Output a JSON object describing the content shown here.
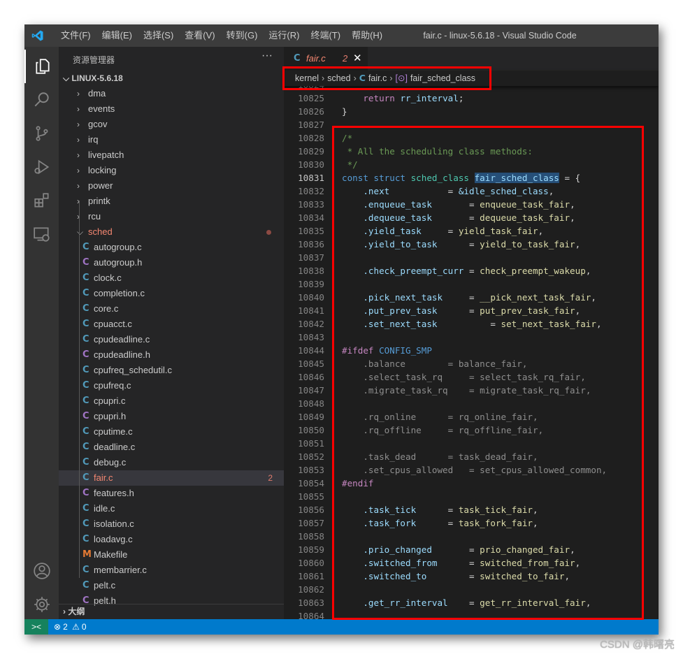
{
  "titlebar": {
    "menu": [
      "文件(F)",
      "编辑(E)",
      "选择(S)",
      "查看(V)",
      "转到(G)",
      "运行(R)",
      "终端(T)",
      "帮助(H)"
    ],
    "title": "fair.c - linux-5.6.18 - Visual Studio Code"
  },
  "activity": [
    "explorer-icon",
    "search-icon",
    "source-control-icon",
    "run-debug-icon",
    "extensions-icon",
    "remote-explorer-icon",
    "account-icon",
    "settings-gear-icon"
  ],
  "sidebar": {
    "header": "资源管理器",
    "more": "···",
    "root": "LINUX-5.6.18",
    "folders": [
      "dma",
      "events",
      "gcov",
      "irq",
      "livepatch",
      "locking",
      "power",
      "printk",
      "rcu"
    ],
    "open_folder": "sched",
    "files": [
      {
        "name": "autogroup.c",
        "icon": "C",
        "type": "c"
      },
      {
        "name": "autogroup.h",
        "icon": "C",
        "type": "h"
      },
      {
        "name": "clock.c",
        "icon": "C",
        "type": "c"
      },
      {
        "name": "completion.c",
        "icon": "C",
        "type": "c"
      },
      {
        "name": "core.c",
        "icon": "C",
        "type": "c"
      },
      {
        "name": "cpuacct.c",
        "icon": "C",
        "type": "c"
      },
      {
        "name": "cpudeadline.c",
        "icon": "C",
        "type": "c"
      },
      {
        "name": "cpudeadline.h",
        "icon": "C",
        "type": "h"
      },
      {
        "name": "cpufreq_schedutil.c",
        "icon": "C",
        "type": "c"
      },
      {
        "name": "cpufreq.c",
        "icon": "C",
        "type": "c"
      },
      {
        "name": "cpupri.c",
        "icon": "C",
        "type": "c"
      },
      {
        "name": "cpupri.h",
        "icon": "C",
        "type": "h"
      },
      {
        "name": "cputime.c",
        "icon": "C",
        "type": "c"
      },
      {
        "name": "deadline.c",
        "icon": "C",
        "type": "c"
      },
      {
        "name": "debug.c",
        "icon": "C",
        "type": "c"
      },
      {
        "name": "fair.c",
        "icon": "C",
        "type": "c",
        "selected": true,
        "badge": "2"
      },
      {
        "name": "features.h",
        "icon": "C",
        "type": "h"
      },
      {
        "name": "idle.c",
        "icon": "C",
        "type": "c"
      },
      {
        "name": "isolation.c",
        "icon": "C",
        "type": "c"
      },
      {
        "name": "loadavg.c",
        "icon": "C",
        "type": "c"
      },
      {
        "name": "Makefile",
        "icon": "M",
        "type": "make"
      },
      {
        "name": "membarrier.c",
        "icon": "C",
        "type": "c"
      },
      {
        "name": "pelt.c",
        "icon": "C",
        "type": "c"
      },
      {
        "name": "pelt.h",
        "icon": "C",
        "type": "h"
      }
    ],
    "outline": "大纲"
  },
  "colors": {
    "c": "#519aba",
    "h": "#a074c4",
    "make": "#e37933",
    "error": "#f48771",
    "accent": "#007acc",
    "highlight_box": "#ff0000"
  },
  "tab": {
    "icon": "C",
    "name": "fair.c",
    "count": "2",
    "close": "✕"
  },
  "breadcrumb": {
    "items": [
      "kernel",
      "sched",
      "fair.c",
      "fair_sched_class"
    ]
  },
  "code": {
    "current_line": 10831,
    "highlight_word": "fair_sched_class",
    "lines": [
      {
        "n": 10824,
        "t": ""
      },
      {
        "n": 10825,
        "t": "    return rr_interval;"
      },
      {
        "n": 10826,
        "t": "}"
      },
      {
        "n": 10827,
        "t": ""
      },
      {
        "n": 10828,
        "t": "/*"
      },
      {
        "n": 10829,
        "t": " * All the scheduling class methods:"
      },
      {
        "n": 10830,
        "t": " */"
      },
      {
        "n": 10831,
        "t": "const struct sched_class fair_sched_class = {"
      },
      {
        "n": 10832,
        "t": "    .next           = &idle_sched_class,"
      },
      {
        "n": 10833,
        "t": "    .enqueue_task       = enqueue_task_fair,"
      },
      {
        "n": 10834,
        "t": "    .dequeue_task       = dequeue_task_fair,"
      },
      {
        "n": 10835,
        "t": "    .yield_task     = yield_task_fair,"
      },
      {
        "n": 10836,
        "t": "    .yield_to_task      = yield_to_task_fair,"
      },
      {
        "n": 10837,
        "t": ""
      },
      {
        "n": 10838,
        "t": "    .check_preempt_curr = check_preempt_wakeup,"
      },
      {
        "n": 10839,
        "t": ""
      },
      {
        "n": 10840,
        "t": "    .pick_next_task     = __pick_next_task_fair,"
      },
      {
        "n": 10841,
        "t": "    .put_prev_task      = put_prev_task_fair,"
      },
      {
        "n": 10842,
        "t": "    .set_next_task          = set_next_task_fair,"
      },
      {
        "n": 10843,
        "t": ""
      },
      {
        "n": 10844,
        "t": "#ifdef CONFIG_SMP"
      },
      {
        "n": 10845,
        "t": "    .balance        = balance_fair,",
        "inactive": true
      },
      {
        "n": 10846,
        "t": "    .select_task_rq     = select_task_rq_fair,",
        "inactive": true
      },
      {
        "n": 10847,
        "t": "    .migrate_task_rq    = migrate_task_rq_fair,",
        "inactive": true
      },
      {
        "n": 10848,
        "t": "",
        "inactive": true
      },
      {
        "n": 10849,
        "t": "    .rq_online      = rq_online_fair,",
        "inactive": true
      },
      {
        "n": 10850,
        "t": "    .rq_offline     = rq_offline_fair,",
        "inactive": true
      },
      {
        "n": 10851,
        "t": "",
        "inactive": true
      },
      {
        "n": 10852,
        "t": "    .task_dead      = task_dead_fair,",
        "inactive": true
      },
      {
        "n": 10853,
        "t": "    .set_cpus_allowed   = set_cpus_allowed_common,",
        "inactive": true
      },
      {
        "n": 10854,
        "t": "#endif"
      },
      {
        "n": 10855,
        "t": ""
      },
      {
        "n": 10856,
        "t": "    .task_tick      = task_tick_fair,"
      },
      {
        "n": 10857,
        "t": "    .task_fork      = task_fork_fair,"
      },
      {
        "n": 10858,
        "t": ""
      },
      {
        "n": 10859,
        "t": "    .prio_changed       = prio_changed_fair,"
      },
      {
        "n": 10860,
        "t": "    .switched_from      = switched_from_fair,"
      },
      {
        "n": 10861,
        "t": "    .switched_to        = switched_to_fair,"
      },
      {
        "n": 10862,
        "t": ""
      },
      {
        "n": 10863,
        "t": "    .get_rr_interval    = get_rr_interval_fair,"
      },
      {
        "n": 10864,
        "t": ""
      }
    ]
  },
  "status": {
    "remote": "><",
    "errors": "2",
    "warnings": "0"
  },
  "watermark": "CSDN @韩曙亮"
}
